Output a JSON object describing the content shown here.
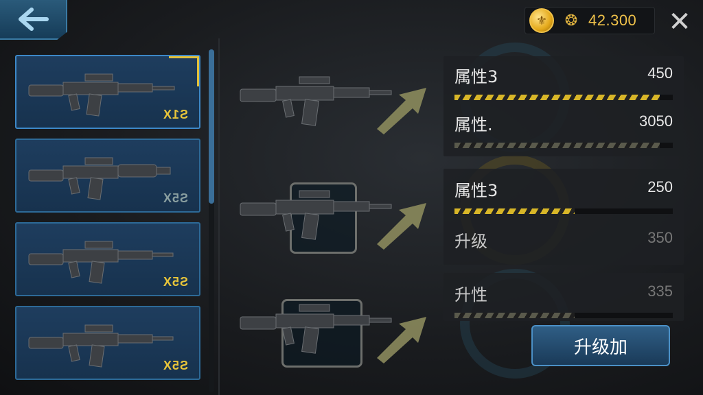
{
  "header": {
    "currency_amount": "42.300",
    "back_icon": "back-arrow-icon",
    "close_icon": "close-icon"
  },
  "weapon_list": [
    {
      "rank": "S1X",
      "selected": true
    },
    {
      "rank": "S5X",
      "selected": false
    },
    {
      "rank": "S5X",
      "selected": false
    },
    {
      "rank": "S5X",
      "selected": false
    }
  ],
  "stat_panels": [
    {
      "rows": [
        {
          "label": "属性3",
          "value": "450",
          "fill": 0.94,
          "style": "gold"
        },
        {
          "label": "属性.",
          "value": "3050",
          "fill": 0.94,
          "style": "dark"
        }
      ]
    },
    {
      "rows": [
        {
          "label": "属性3",
          "value": "250",
          "fill": 0.55,
          "style": "gold"
        },
        {
          "label": "升级",
          "value": "350",
          "fill": 0,
          "style": "none"
        }
      ]
    },
    {
      "rows": [
        {
          "label": "升性",
          "value": "335",
          "fill": 0.55,
          "style": "dark"
        }
      ]
    }
  ],
  "upgrade_button_label": "升级加",
  "colors": {
    "accent_gold": "#e2c13a",
    "card_blue": "#1e3d5e",
    "card_border": "#2d6a98"
  }
}
